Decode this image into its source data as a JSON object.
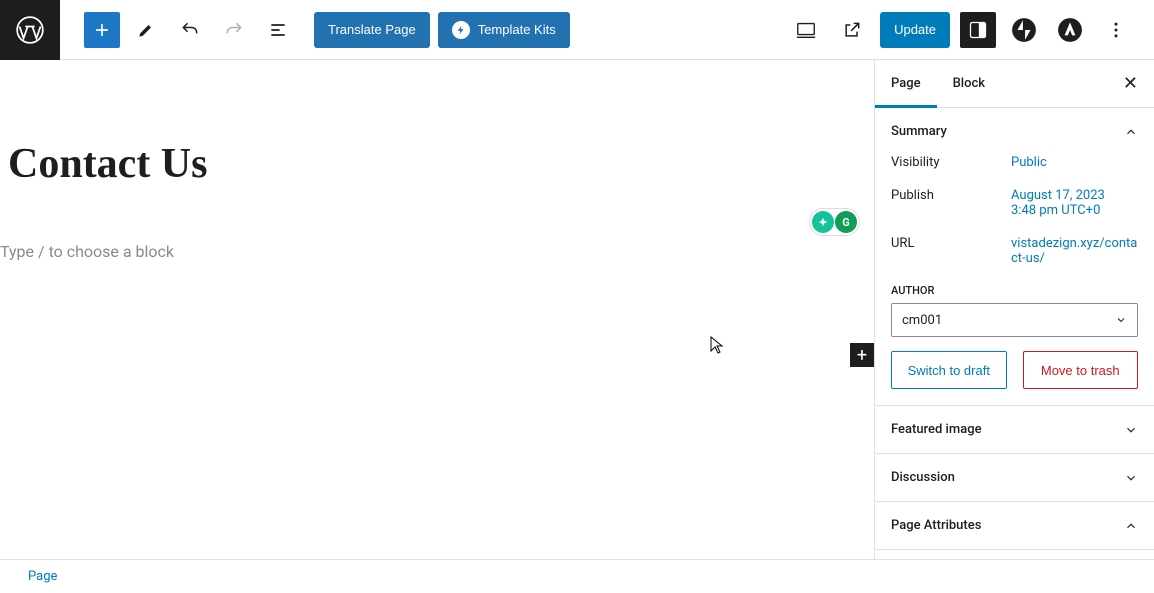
{
  "toolbar": {
    "translate_label": "Translate Page",
    "template_kits_label": "Template Kits",
    "update_label": "Update"
  },
  "editor": {
    "title": "Contact Us",
    "placeholder": "Type / to choose a block"
  },
  "sidebar": {
    "tabs": {
      "page": "Page",
      "block": "Block"
    },
    "summary": {
      "title": "Summary",
      "visibility_label": "Visibility",
      "visibility_value": "Public",
      "publish_label": "Publish",
      "publish_line1": "August 17, 2023",
      "publish_line2": "3:48 pm UTC+0",
      "url_label": "URL",
      "url_value": "vistadezign.xyz/contact-us/",
      "author_label": "AUTHOR",
      "author_value": "cm001",
      "switch_draft": "Switch to draft",
      "move_trash": "Move to trash"
    },
    "panels": {
      "featured_image": "Featured image",
      "discussion": "Discussion",
      "page_attributes": "Page Attributes"
    }
  },
  "bottombar": {
    "label": "Page"
  }
}
